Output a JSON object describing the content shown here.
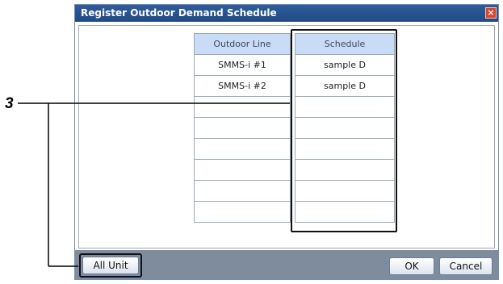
{
  "dialog": {
    "title": "Register Outdoor Demand Schedule",
    "close_label": "×"
  },
  "table": {
    "columns": [
      "Outdoor Line",
      "Schedule"
    ],
    "rows": [
      [
        "SMMS-i #1",
        "sample D"
      ],
      [
        "SMMS-i #2",
        "sample D"
      ],
      [
        "",
        ""
      ],
      [
        "",
        ""
      ],
      [
        "",
        ""
      ],
      [
        "",
        ""
      ],
      [
        "",
        ""
      ],
      [
        "",
        ""
      ]
    ]
  },
  "buttons": {
    "all_unit": "All Unit",
    "ok": "OK",
    "cancel": "Cancel"
  },
  "callout": {
    "number": "3"
  },
  "colors": {
    "titlebar": "#214a85",
    "header_fill": "#c8dcf5",
    "footer": "#7e8c9e",
    "close_button": "#d9462e"
  }
}
